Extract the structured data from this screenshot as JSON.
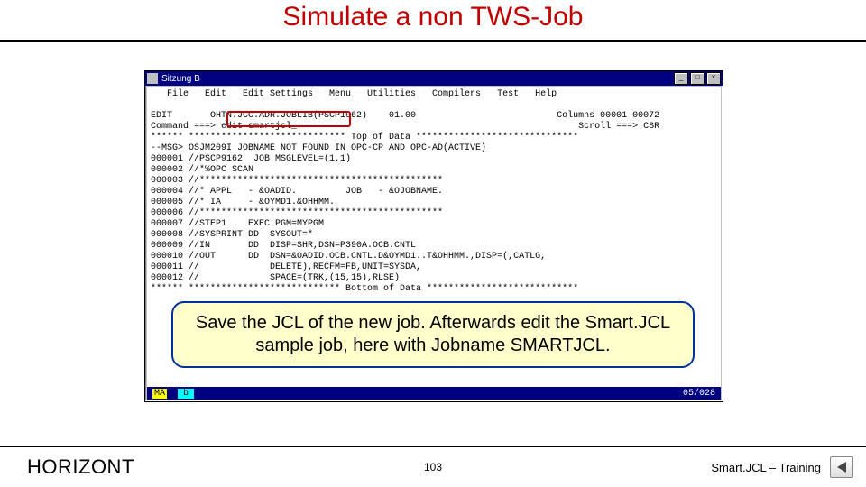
{
  "title": "Simulate a non TWS-Job",
  "window": {
    "caption": "Sitzung B",
    "statusbar": {
      "left1": "MA",
      "left2": "b",
      "right": "05/028"
    }
  },
  "menubar": "   File   Edit   Edit Settings   Menu   Utilities   Compilers   Test   Help",
  "editor": {
    "line_hdr1_left": "EDIT       OHTN.JCC.ADR.JOBLIB(PSCP1962)    01.00",
    "line_hdr1_right": "Columns 00001 00072",
    "line_cmd_left": "Command ===> edit smartjcl_",
    "line_cmd_right": "Scroll ===> CSR",
    "lines": [
      "****** ***************************** Top of Data ******************************",
      "--MSG> OSJM209I JOBNAME NOT FOUND IN OPC-CP AND OPC-AD(ACTIVE)",
      "000001 //PSCP9162  JOB MSGLEVEL=(1,1)",
      "000002 //*%OPC SCAN",
      "000003 //*********************************************",
      "000004 //* APPL   - &OADID.         JOB   - &OJOBNAME.",
      "000005 //* IA     - &OYMD1.&OHHMM.",
      "000006 //*********************************************",
      "000007 //STEP1    EXEC PGM=MYPGM",
      "000008 //SYSPRINT DD  SYSOUT=*",
      "000009 //IN       DD  DISP=SHR,DSN=P390A.OCB.CNTL",
      "000010 //OUT      DD  DSN=&OADID.OCB.CNTL.D&OYMD1..T&OHHMM.,DISP=(,CATLG,",
      "000011 //             DELETE),RECFM=FB,UNIT=SYSDA,",
      "000012 //             SPACE=(TRK,(15,15),RLSE)",
      "****** **************************** Bottom of Data ****************************"
    ]
  },
  "callout": "Save the JCL of the new job. Afterwards edit the Smart.JCL sample job, here with Jobname SMARTJCL.",
  "footer": {
    "brand": "HORIZONT",
    "page": "103",
    "course": "Smart.JCL – Training"
  }
}
